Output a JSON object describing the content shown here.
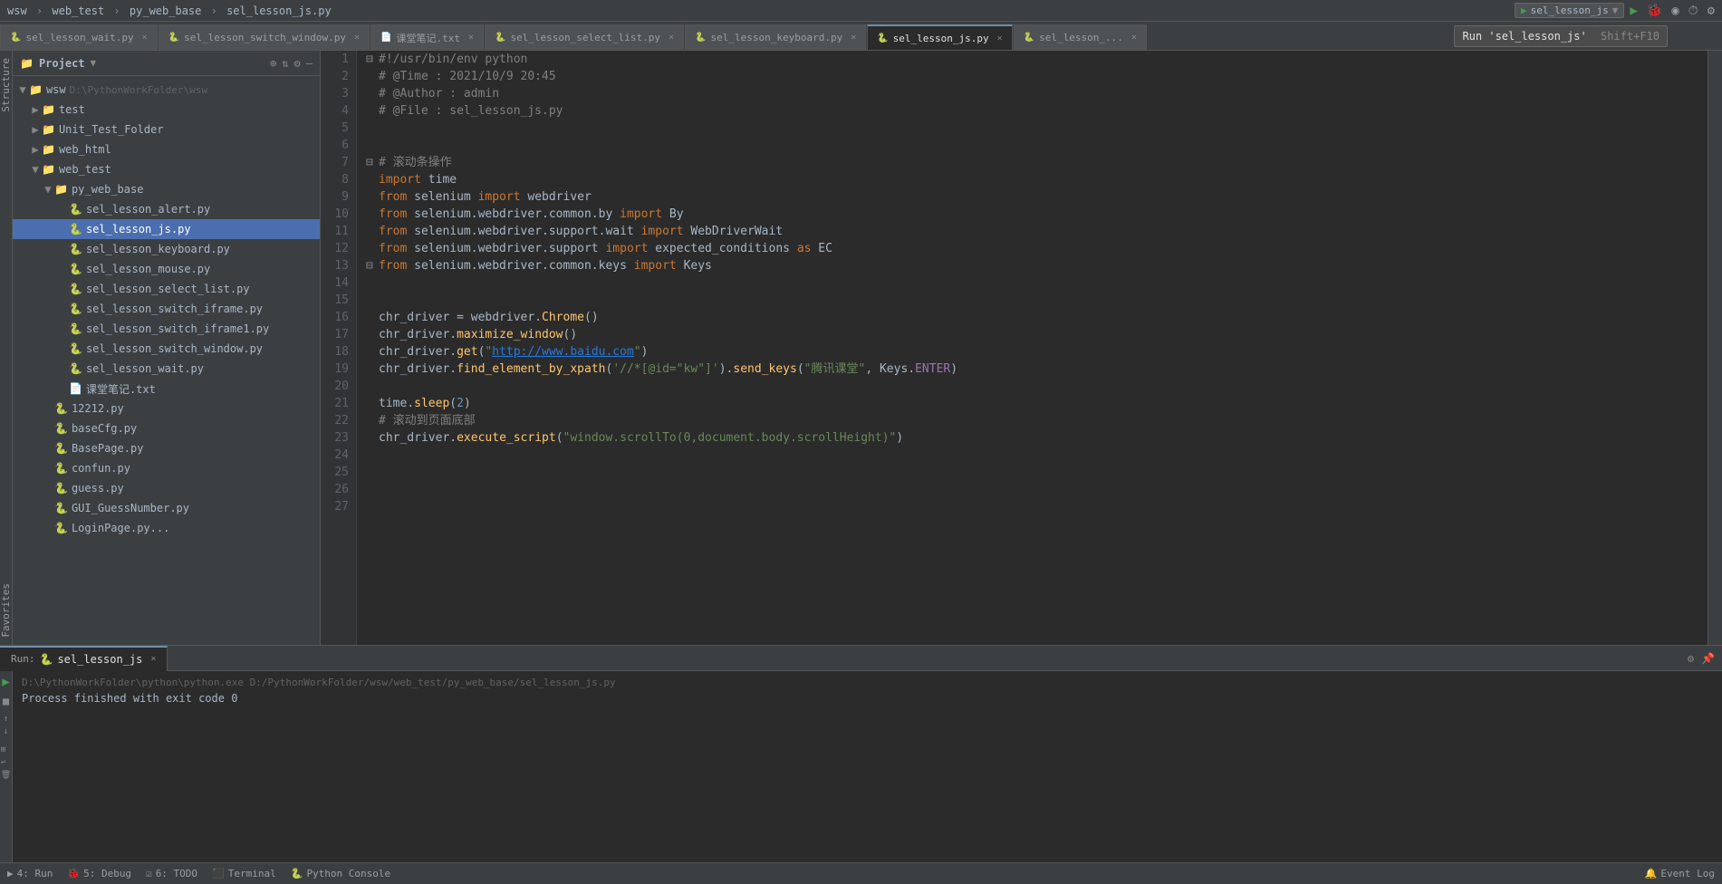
{
  "title_bar": {
    "project": "wsw",
    "separator1": "›",
    "web_test": "web_test",
    "separator2": "›",
    "py_web_base": "py_web_base",
    "separator3": "›",
    "current_file": "sel_lesson_js.py"
  },
  "tabs": [
    {
      "id": "tab1",
      "label": "sel_lesson_wait.py",
      "active": false
    },
    {
      "id": "tab2",
      "label": "sel_lesson_switch_window.py",
      "active": false
    },
    {
      "id": "tab3",
      "label": "课堂笔记.txt",
      "active": false
    },
    {
      "id": "tab4",
      "label": "sel_lesson_select_list.py",
      "active": false
    },
    {
      "id": "tab5",
      "label": "sel_lesson_keyboard.py",
      "active": false
    },
    {
      "id": "tab6",
      "label": "sel_lesson_js.py",
      "active": true
    },
    {
      "id": "tab7",
      "label": "sel_lesson_...",
      "active": false
    }
  ],
  "project_panel": {
    "title": "Project",
    "wsw_root": {
      "label": "wsw",
      "path": "D:\\PythonWorkFolder\\wsw"
    },
    "tree": [
      {
        "indent": 1,
        "type": "folder",
        "label": "test",
        "expanded": false
      },
      {
        "indent": 1,
        "type": "folder",
        "label": "Unit_Test_Folder",
        "expanded": false
      },
      {
        "indent": 1,
        "type": "folder",
        "label": "web_html",
        "expanded": false
      },
      {
        "indent": 1,
        "type": "folder",
        "label": "web_test",
        "expanded": true
      },
      {
        "indent": 2,
        "type": "folder",
        "label": "py_web_base",
        "expanded": true
      },
      {
        "indent": 3,
        "type": "py",
        "label": "sel_lesson_alert.py"
      },
      {
        "indent": 3,
        "type": "py",
        "label": "sel_lesson_js.py",
        "selected": true
      },
      {
        "indent": 3,
        "type": "py",
        "label": "sel_lesson_keyboard.py"
      },
      {
        "indent": 3,
        "type": "py",
        "label": "sel_lesson_mouse.py"
      },
      {
        "indent": 3,
        "type": "py",
        "label": "sel_lesson_select_list.py"
      },
      {
        "indent": 3,
        "type": "py",
        "label": "sel_lesson_switch_iframe.py"
      },
      {
        "indent": 3,
        "type": "py",
        "label": "sel_lesson_switch_iframe1.py"
      },
      {
        "indent": 3,
        "type": "py",
        "label": "sel_lesson_switch_window.py"
      },
      {
        "indent": 3,
        "type": "py",
        "label": "sel_lesson_wait.py"
      },
      {
        "indent": 3,
        "type": "txt",
        "label": "课堂笔记.txt"
      },
      {
        "indent": 2,
        "type": "py",
        "label": "12212.py"
      },
      {
        "indent": 2,
        "type": "py",
        "label": "baseCfg.py"
      },
      {
        "indent": 2,
        "type": "py",
        "label": "BasePage.py"
      },
      {
        "indent": 2,
        "type": "py",
        "label": "confun.py"
      },
      {
        "indent": 2,
        "type": "py",
        "label": "guess.py"
      },
      {
        "indent": 2,
        "type": "py",
        "label": "GUI_GuessNumber.py"
      },
      {
        "indent": 2,
        "type": "py",
        "label": "LoginPage.py..."
      }
    ]
  },
  "code": {
    "filename": "sel_lesson_js.py",
    "lines": [
      {
        "num": 1,
        "fold": true,
        "content": "#!/usr/bin/env python"
      },
      {
        "num": 2,
        "fold": false,
        "content": "# @Time : 2021/10/9 20:45"
      },
      {
        "num": 3,
        "fold": false,
        "content": "# @Author : admin"
      },
      {
        "num": 4,
        "fold": false,
        "content": "# @File : sel_lesson_js.py"
      },
      {
        "num": 5,
        "fold": false,
        "content": ""
      },
      {
        "num": 6,
        "fold": false,
        "content": ""
      },
      {
        "num": 7,
        "fold": true,
        "content": "# 滚动条操作"
      },
      {
        "num": 8,
        "fold": false,
        "content": "import time"
      },
      {
        "num": 9,
        "fold": false,
        "content": "from selenium import webdriver"
      },
      {
        "num": 10,
        "fold": false,
        "content": "from selenium.webdriver.common.by import By"
      },
      {
        "num": 11,
        "fold": false,
        "content": "from selenium.webdriver.support.wait import WebDriverWait"
      },
      {
        "num": 12,
        "fold": false,
        "content": "from selenium.webdriver.support import expected_conditions as EC"
      },
      {
        "num": 13,
        "fold": true,
        "content": "from selenium.webdriver.common.keys import Keys"
      },
      {
        "num": 14,
        "fold": false,
        "content": ""
      },
      {
        "num": 15,
        "fold": false,
        "content": ""
      },
      {
        "num": 16,
        "fold": false,
        "content": "chr_driver = webdriver.Chrome()"
      },
      {
        "num": 17,
        "fold": false,
        "content": "chr_driver.maximize_window()"
      },
      {
        "num": 18,
        "fold": false,
        "content": "chr_driver.get(\"http://www.baidu.com\")"
      },
      {
        "num": 19,
        "fold": false,
        "content": "chr_driver.find_element_by_xpath('//*[@id=\"kw\"]').send_keys(\"腾讯课堂\", Keys.ENTER)"
      },
      {
        "num": 20,
        "fold": false,
        "content": ""
      },
      {
        "num": 21,
        "fold": false,
        "content": "time.sleep(2)"
      },
      {
        "num": 22,
        "fold": false,
        "content": "# 滚动到页面底部"
      },
      {
        "num": 23,
        "fold": false,
        "content": "chr_driver.execute_script(\"window.scrollTo(0,document.body.scrollHeight)\")"
      },
      {
        "num": 24,
        "fold": false,
        "content": ""
      },
      {
        "num": 25,
        "fold": false,
        "content": ""
      },
      {
        "num": 26,
        "fold": false,
        "content": ""
      },
      {
        "num": 27,
        "fold": false,
        "content": ""
      }
    ]
  },
  "run_panel": {
    "run_label": "Run:",
    "tab_label": "sel_lesson_js",
    "cmd_line": "D:\\PythonWorkFolder\\python\\python.exe D:/PythonWorkFolder/wsw/web_test/py_web_base/sel_lesson_js.py",
    "output": "Process finished with exit code 0"
  },
  "toolbar": {
    "run_config": "sel_lesson_js",
    "run_tooltip": "Run 'sel_lesson_js'",
    "run_shortcut": "Shift+F10"
  },
  "status_bar": {
    "run_number": "4: Run",
    "debug_number": "5: Debug",
    "todo_number": "6: TODO",
    "terminal_label": "Terminal",
    "python_console_label": "Python Console",
    "event_log_label": "Event Log"
  }
}
